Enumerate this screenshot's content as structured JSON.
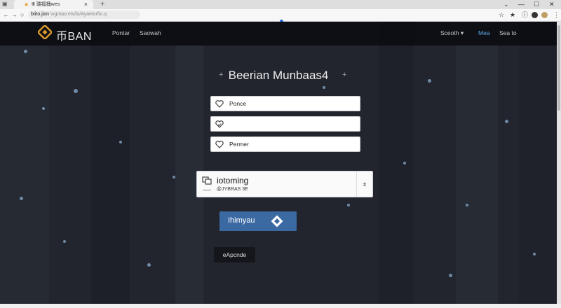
{
  "browser": {
    "tab_title": "Ⅲ 瑞福捅wes",
    "tab_close": "×",
    "new_tab": "+",
    "address_host": "btito.jion",
    "address_path": "\\vgntao:eis/lo/Ayaeiorfio.q",
    "icons": [
      "back-icon",
      "forward-icon",
      "reload-icon",
      "star-icon",
      "pin-icon",
      "info-icon",
      "menu-dots-icon"
    ]
  },
  "site": {
    "brand": "币BAN",
    "nav_left": [
      "Pontar",
      "Saowah"
    ],
    "nav_right": {
      "search": "Sceoth",
      "meta": "Mea",
      "last": "Sea to"
    },
    "accent_color": "#5aa8e6"
  },
  "main": {
    "heading": "Beerian Munbaas4",
    "fields": [
      {
        "value": "Ponce",
        "icon": "heart-icon"
      },
      {
        "value": "",
        "icon": "heart-check-icon"
      },
      {
        "value": "Permer",
        "icon": "heart-icon"
      }
    ],
    "card": {
      "title": "iotoming",
      "subtitle": "@JYBRAS 3E",
      "action": "±"
    },
    "primary_button": "Ihimyau",
    "secondary_button": "eApcnde"
  }
}
